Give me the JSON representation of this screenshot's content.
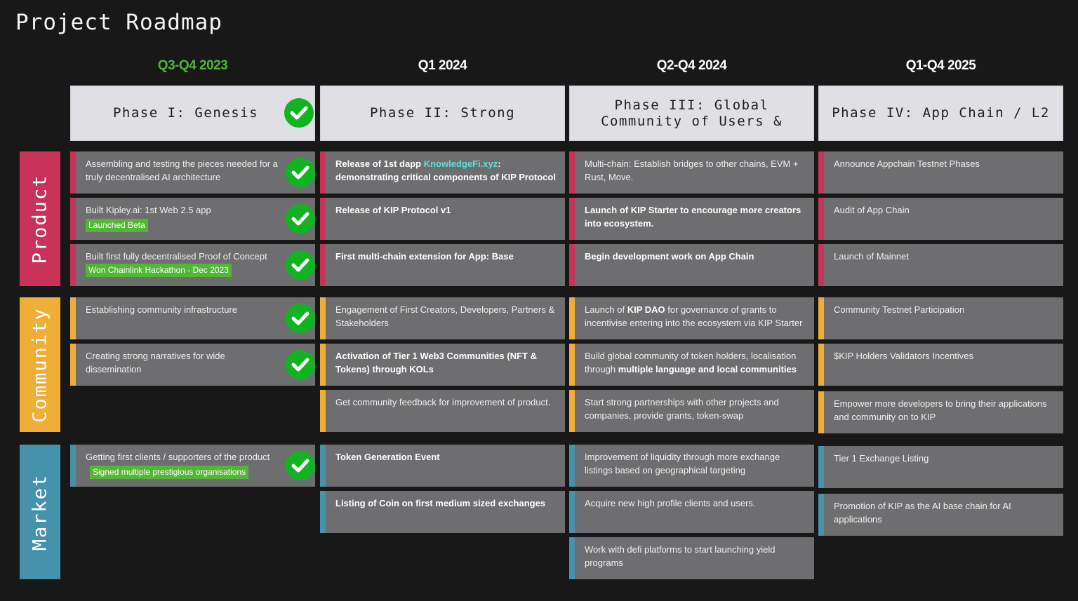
{
  "title": "Project Roadmap",
  "colors": {
    "background": "#181818",
    "product": "#c93259",
    "community": "#efae38",
    "market": "#4592ab",
    "done_green": "#12b322",
    "tag_green": "#52b636",
    "completed_quarter": "#52b636",
    "link": "#5de0d8"
  },
  "columns": [
    {
      "quarter": "Q3-Q4 2023",
      "phase": "Phase I: Genesis",
      "completed": true
    },
    {
      "quarter": "Q1 2024",
      "phase": "Phase II: Strong",
      "completed": false
    },
    {
      "quarter": "Q2-Q4 2024",
      "phase_line1": "Phase III: Global",
      "phase_line2": "Community of Users &",
      "completed": false
    },
    {
      "quarter": "Q1-Q4 2025",
      "phase": "Phase IV: App Chain / L2",
      "completed": false
    }
  ],
  "categories": {
    "product": "Product",
    "community": "Community",
    "market": "Market"
  },
  "items": {
    "product": {
      "c0": [
        {
          "text": "Assembling and testing the pieces needed for a truly decentralised AI architecture",
          "done": true
        },
        {
          "text": "Built Kipley.ai: 1st Web 2.5 app",
          "tag": "Launched Beta",
          "done": true
        },
        {
          "text": "Built first fully decentralised Proof of Concept",
          "tag": "Won Chainlink Hackathon - Dec 2023",
          "done": true
        }
      ],
      "c1": [
        {
          "pre": "Release of 1st dapp ",
          "link": "KnowledgeFi.xyz",
          "post": ": demonstrating critical components of KIP Protocol"
        },
        {
          "text": "Release of KIP Protocol v1"
        },
        {
          "text": "First multi-chain extension for App: Base"
        }
      ],
      "c2": [
        {
          "text": "Multi-chain: Establish bridges to other chains, EVM + Rust, Move."
        },
        {
          "text": "Launch of KIP Starter to encourage more creators into ecosystem."
        },
        {
          "text": "Begin development work on App Chain"
        }
      ],
      "c3": [
        {
          "text": "Announce Appchain Testnet Phases"
        },
        {
          "text": "Audit of App Chain"
        },
        {
          "text": "Launch of Mainnet"
        }
      ]
    },
    "community": {
      "c0": [
        {
          "text": "Establishing community infrastructure",
          "done": true
        },
        {
          "text": "Creating strong narratives for wide dissemination",
          "done": true
        }
      ],
      "c1": [
        {
          "text": "Engagement of First Creators, Developers, Partners & Stakeholders"
        },
        {
          "text": "Activation of Tier 1 Web3 Communities (NFT & Tokens) through KOLs"
        },
        {
          "text": "Get community feedback for improvement of product."
        }
      ],
      "c2": [
        {
          "pre": "Launch of ",
          "bold": "KIP DAO",
          "post": " for governance of grants to incentivise entering into the ecosystem via KIP Starter"
        },
        {
          "pre": "Build global community of token holders, localisation through ",
          "bold": "multiple language and local communities",
          "post": ""
        },
        {
          "text": "Start strong partnerships with other projects and companies, provide grants, token-swap"
        }
      ],
      "c3": [
        {
          "text": "Community Testnet Participation"
        },
        {
          "text": "$KIP Holders Validators Incentives"
        },
        {
          "text": "Empower more developers to bring their applications and community on to KIP"
        }
      ]
    },
    "market": {
      "c0": [
        {
          "text": "Getting first clients / supporters of the product",
          "tag": "Signed multiple prestigious organisations",
          "done": true
        }
      ],
      "c1": [
        {
          "text": "Token Generation Event"
        },
        {
          "text": "Listing of Coin on first medium sized exchanges"
        }
      ],
      "c2": [
        {
          "text": "Improvement of liquidity through more exchange listings based on geographical targeting"
        },
        {
          "text": "Acquire new high profile clients and users."
        },
        {
          "text": "Work with defi platforms to start launching yield programs"
        }
      ],
      "c3": [
        {
          "text": "Tier 1 Exchange Listing"
        },
        {
          "text": "Promotion of KIP as the AI base chain for AI applications"
        }
      ]
    }
  }
}
